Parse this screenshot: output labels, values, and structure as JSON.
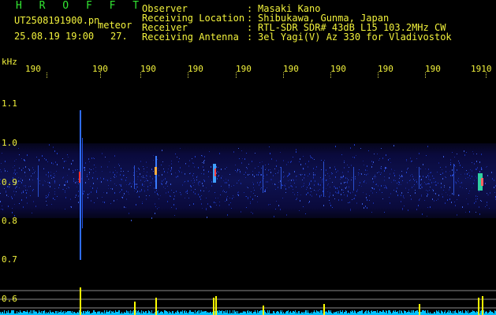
{
  "header": {
    "brand": "H R O F F T",
    "filename": "UT2508191900.pn",
    "suffix": "meteor",
    "datetime": "25.08.19 19:00",
    "count": "27.",
    "fields": [
      {
        "label": "Observer",
        "sep": ":",
        "value": "Masaki Kano"
      },
      {
        "label": "Receiving Location",
        "sep": ":",
        "value": "Shibukawa, Gunma, Japan"
      },
      {
        "label": "Receiver",
        "sep": ":",
        "value": "RTL-SDR SDR# 43dB L15 103.2MHz CW"
      },
      {
        "label": "Receiving Antenna",
        "sep": ":",
        "value": "3el Yagi(V) Az 330 for Vladivostok"
      }
    ]
  },
  "axis": {
    "unit": "kHz",
    "time_ticks": [
      "190",
      "190",
      "190",
      "190",
      "190",
      "190",
      "190",
      "190",
      "190",
      "1910"
    ],
    "freq_ticks": [
      "1.1",
      "1.0",
      "0.9",
      "0.8",
      "0.7",
      "0.6"
    ]
  },
  "colors": {
    "background": "#000000",
    "label_text": "#f2f23c",
    "brand": "#32e632",
    "signal": "#ffff00",
    "noise": "#1e5aff"
  }
}
